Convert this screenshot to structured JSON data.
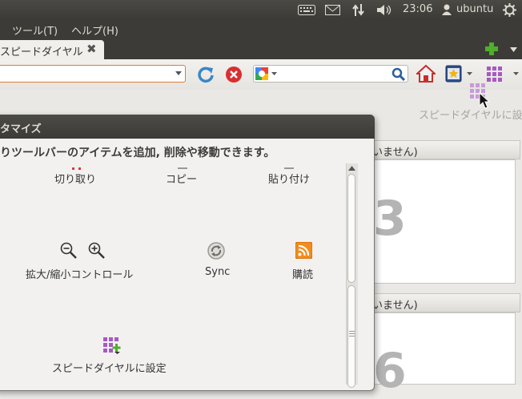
{
  "panel": {
    "clock": "23:06",
    "user": "ubuntu",
    "icons": [
      "keyboard-icon",
      "mail-icon",
      "network-icon",
      "volume-icon",
      "user-icon",
      "power-icon"
    ]
  },
  "menubar": {
    "tools": "ツール(T)",
    "help": "ヘルプ(H)"
  },
  "tab": {
    "label": "スピードダイヤル",
    "close": "✖"
  },
  "content": {
    "speed_dial_hint": "スピードダイヤルに設",
    "tile_top_header": "いません)",
    "tile_top_number": "3",
    "tile_bottom_header": "いません)",
    "tile_bottom_number": "6"
  },
  "dialog": {
    "title": "タマイズ",
    "instruction": "りツールバーのアイテムを追加, 削除や移動できます。",
    "items": {
      "cut": "切り取り",
      "copy": "コピー",
      "paste": "貼り付け",
      "zoom": "拡大/縮小コントロール",
      "sync": "Sync",
      "subscribe": "購読",
      "speed_dial": "スピードダイヤルに設定"
    }
  },
  "colors": {
    "panel_bg": "#3c3b37",
    "url_border": "#e07b39",
    "accent_green": "#4fae2a"
  }
}
